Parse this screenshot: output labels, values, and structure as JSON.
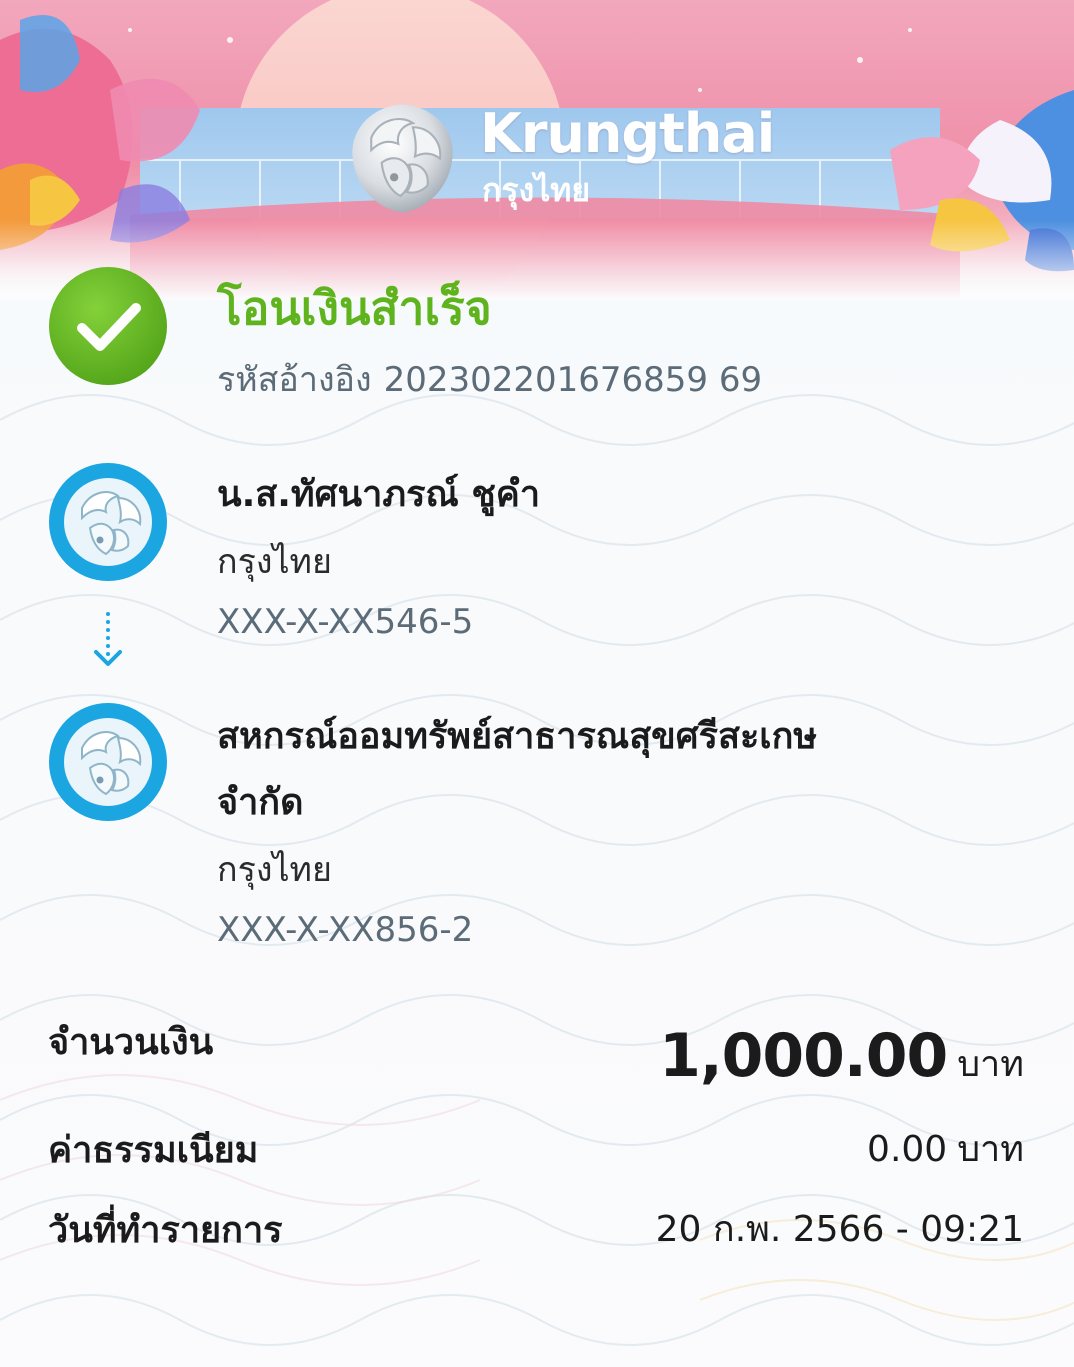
{
  "brand": {
    "name_en": "Krungthai",
    "name_th": "กรุงไทย"
  },
  "status": {
    "title": "โอนเงินสำเร็จ",
    "ref_label": "รหัสอ้างอิง",
    "ref_number": "202302201676859 69"
  },
  "from": {
    "name": "น.ส.ทัศนาภรณ์ ชูคำ",
    "bank": "กรุงไทย",
    "account": "XXX-X-XX546-5"
  },
  "to": {
    "name": "สหกรณ์ออมทรัพย์สาธารณสุขศรีสะเกษ จำกัด",
    "bank": "กรุงไทย",
    "account": "XXX-X-XX856-2"
  },
  "details": {
    "amount_label": "จำนวนเงิน",
    "amount_value": "1,000.00",
    "amount_unit": "บาท",
    "fee_label": "ค่าธรรมเนียม",
    "fee_value": "0.00",
    "fee_unit": "บาท",
    "date_label": "วันที่ทำรายการ",
    "date_value": "20 ก.พ. 2566 - 09:21"
  },
  "colors": {
    "success_green": "#5fb41e",
    "bank_blue": "#1ba5e1",
    "arrow_blue": "#1ba5e1",
    "muted_text": "#5b6b78"
  },
  "icons": {
    "success": "check-circle-icon",
    "bank": "krungthai-logo-icon",
    "arrow": "arrow-down-icon"
  }
}
